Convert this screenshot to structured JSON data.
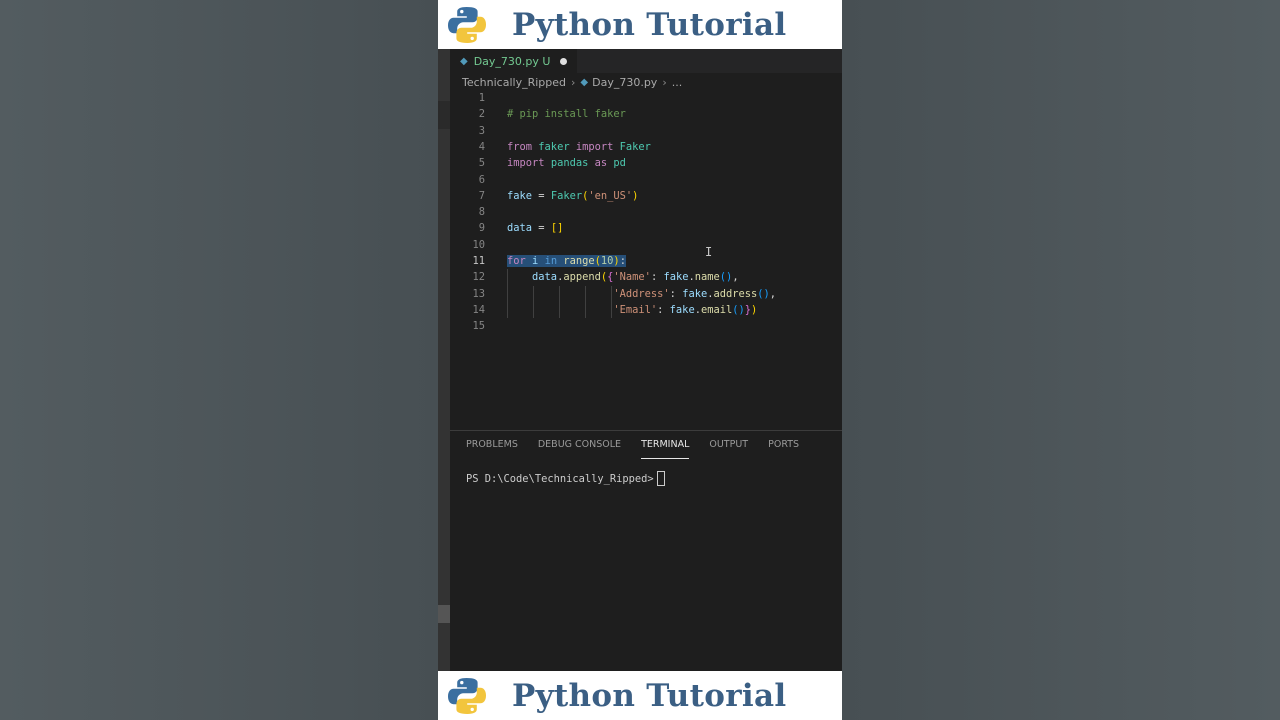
{
  "banner": {
    "title": "Python Tutorial",
    "logo_icon": "python-logo-icon"
  },
  "tab": {
    "filename": "Day_730.py",
    "status": "U",
    "icon": "python-file-icon"
  },
  "breadcrumb": {
    "folder": "Technically_Ripped",
    "file": "Day_730.py",
    "more": "..."
  },
  "editor": {
    "active_line": 11,
    "line_numbers": [
      "1",
      "2",
      "3",
      "4",
      "5",
      "6",
      "7",
      "8",
      "9",
      "10",
      "11",
      "12",
      "13",
      "14",
      "15"
    ],
    "lines": [
      "",
      "# pip install faker",
      "",
      "from faker import Faker",
      "import pandas as pd",
      "",
      "fake = Faker('en_US')",
      "",
      "data = []",
      "",
      "for i in range(10):",
      "    data.append({'Name': fake.name(),",
      "                 'Address': fake.address(),",
      "                 'Email': fake.email()})",
      ""
    ]
  },
  "panel": {
    "tabs": [
      "PROBLEMS",
      "DEBUG CONSOLE",
      "TERMINAL",
      "OUTPUT",
      "PORTS"
    ],
    "active_tab": "TERMINAL",
    "prompt": "PS D:\\Code\\Technically_Ripped>"
  },
  "colors": {
    "banner_text": "#3b5f84",
    "editor_bg": "#1e1e1e",
    "selection": "#264f78"
  }
}
